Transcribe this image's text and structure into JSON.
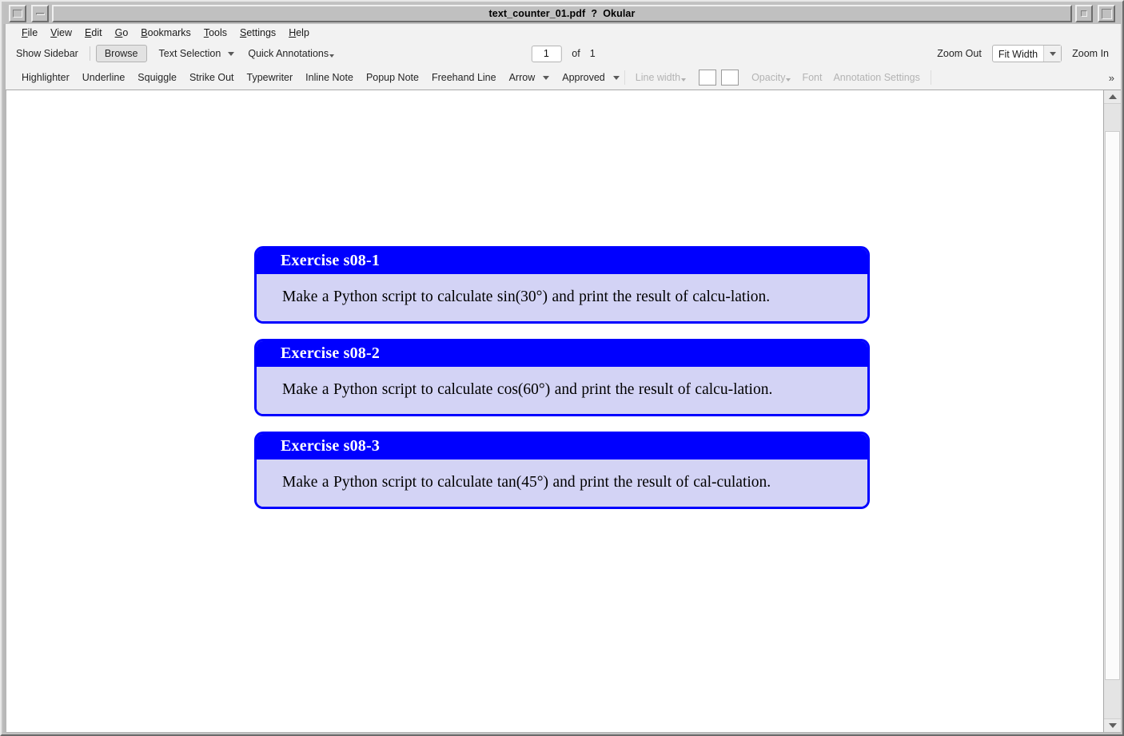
{
  "window": {
    "title": "text_counter_01.pdf  ?  Okular",
    "controls": {
      "menu": "window-menu",
      "minimize": "minimize",
      "restore": "restore",
      "maximize": "maximize"
    }
  },
  "menubar": {
    "items": [
      {
        "label": "File",
        "accel": "F",
        "rest": "ile"
      },
      {
        "label": "View",
        "accel": "V",
        "rest": "iew"
      },
      {
        "label": "Edit",
        "accel": "E",
        "rest": "dit"
      },
      {
        "label": "Go",
        "accel": "G",
        "rest": "o"
      },
      {
        "label": "Bookmarks",
        "accel": "B",
        "rest": "ookmarks"
      },
      {
        "label": "Tools",
        "accel": "T",
        "rest": "ools"
      },
      {
        "label": "Settings",
        "accel": "S",
        "rest": "ettings"
      },
      {
        "label": "Help",
        "accel": "H",
        "rest": "elp"
      }
    ]
  },
  "toolbar": {
    "show_sidebar": "Show Sidebar",
    "browse": "Browse",
    "text_selection": "Text Selection",
    "quick_annotations": "Quick Annotations",
    "page_current": "1",
    "page_of": "of",
    "page_total": "1",
    "zoom_out": "Zoom Out",
    "zoom_level": "Fit Width",
    "zoom_in": "Zoom In"
  },
  "annotation_toolbar": {
    "tools": [
      "Highlighter",
      "Underline",
      "Squiggle",
      "Strike Out",
      "Typewriter",
      "Inline Note",
      "Popup Note",
      "Freehand Line"
    ],
    "arrow": "Arrow",
    "approved": "Approved",
    "line_width": "Line width",
    "opacity": "Opacity",
    "font": "Font",
    "annotation_settings": "Annotation Settings",
    "overflow": "»",
    "swatch_1_color": "#ffffff",
    "swatch_2_color": "#ffffff"
  },
  "document": {
    "header_color": "#0000ff",
    "body_color": "#d3d3f5",
    "border_color": "#0000ff",
    "exercises": [
      {
        "title": "Exercise s08-1",
        "text": "Make a Python script to calculate sin(30°) and print the result of calcu-lation."
      },
      {
        "title": "Exercise s08-2",
        "text": "Make a Python script to calculate cos(60°) and print the result of calcu-lation."
      },
      {
        "title": "Exercise s08-3",
        "text": "Make a Python script to calculate tan(45°) and print the result of cal-culation."
      }
    ]
  }
}
